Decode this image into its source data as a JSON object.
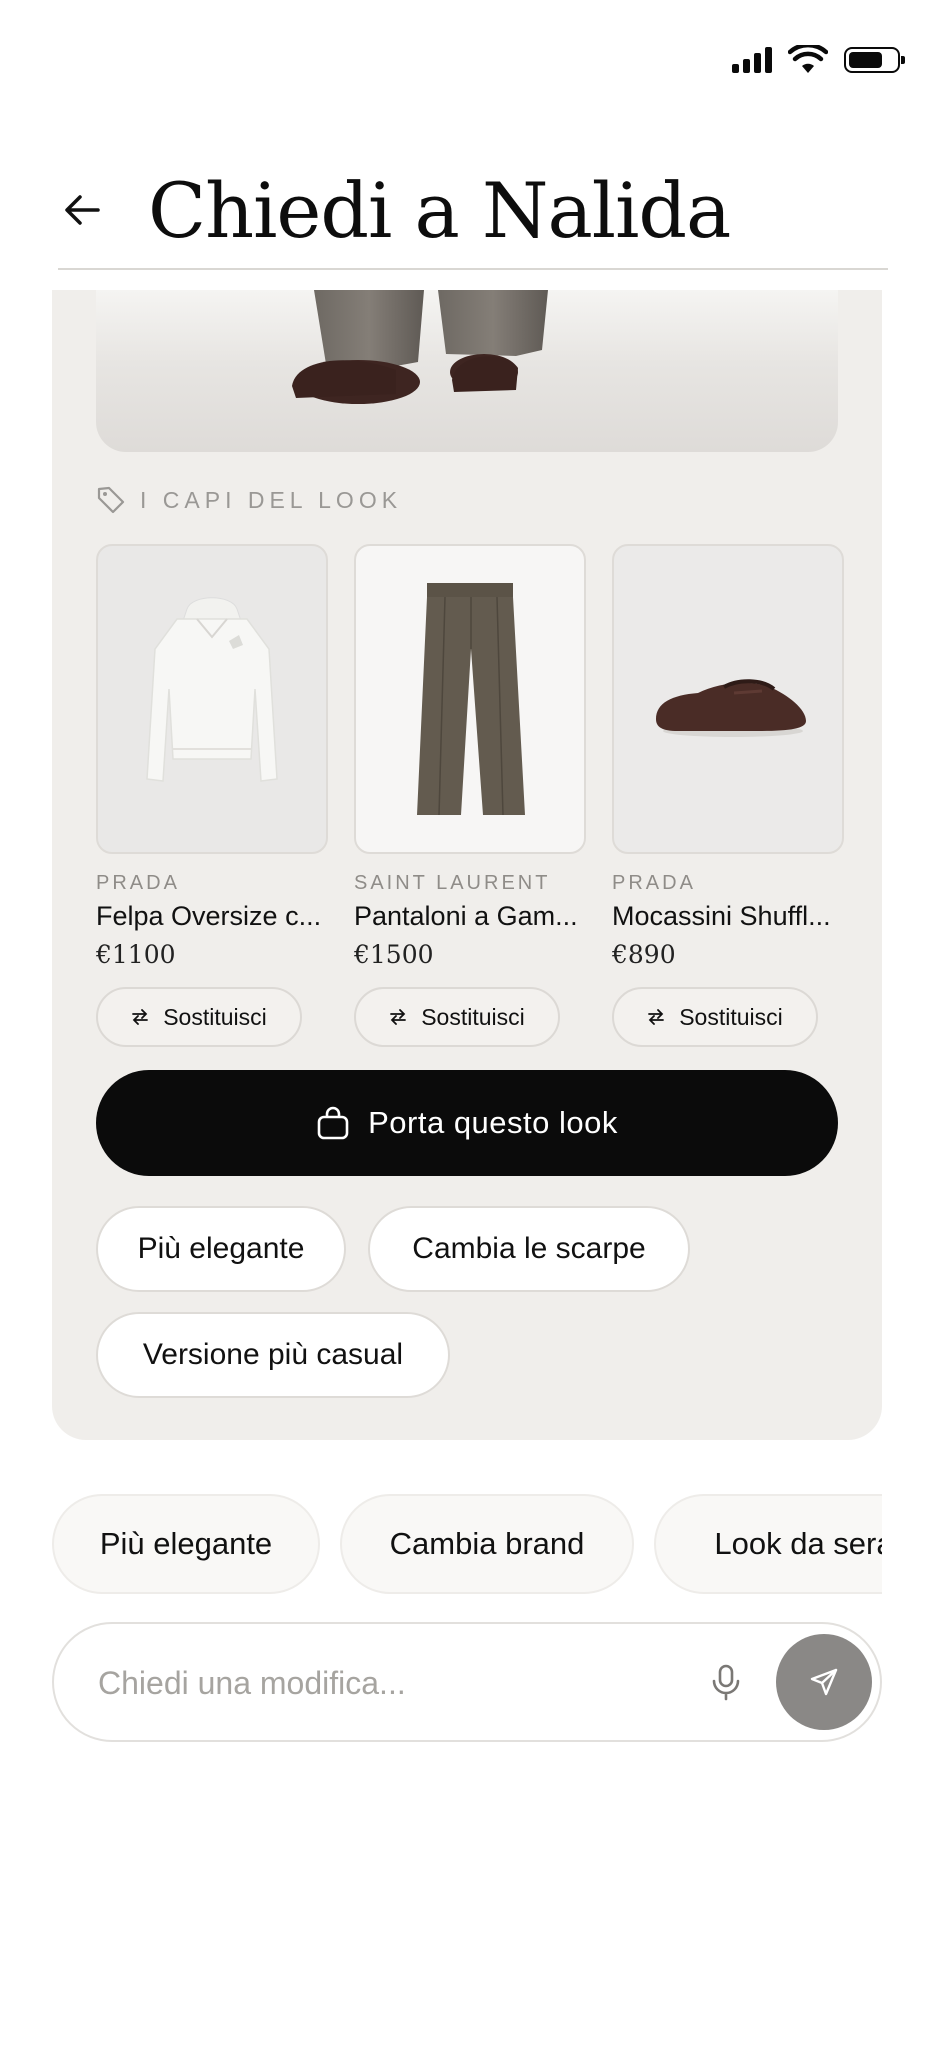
{
  "status_bar": {
    "icons": [
      "signal-icon",
      "wifi-icon",
      "battery-icon"
    ]
  },
  "header": {
    "title": "Chiedi a Nalida",
    "back_icon": "arrow-left-icon"
  },
  "look": {
    "section_label": "I CAPI DEL LOOK",
    "items": [
      {
        "brand": "PRADA",
        "name": "Felpa Oversize c...",
        "price": "€1100",
        "swap_label": "Sostituisci"
      },
      {
        "brand": "SAINT LAURENT",
        "name": "Pantaloni a Gam...",
        "price": "€1500",
        "swap_label": "Sostituisci"
      },
      {
        "brand": "PRADA",
        "name": "Mocassini Shuffl...",
        "price": "€890",
        "swap_label": "Sostituisci"
      }
    ],
    "cta_label": "Porta questo look",
    "refine_chips": [
      "Più elegante",
      "Cambia le scarpe",
      "Versione più casual"
    ]
  },
  "suggestions": [
    "Più elegante",
    "Cambia brand",
    "Look da sera"
  ],
  "composer": {
    "placeholder": "Chiedi una modifica...",
    "value": ""
  },
  "colors": {
    "card_bg": "#f0eeeb",
    "cta_bg": "#0b0b0b",
    "send_bg": "#8a8886",
    "muted_text": "#9a9895"
  }
}
